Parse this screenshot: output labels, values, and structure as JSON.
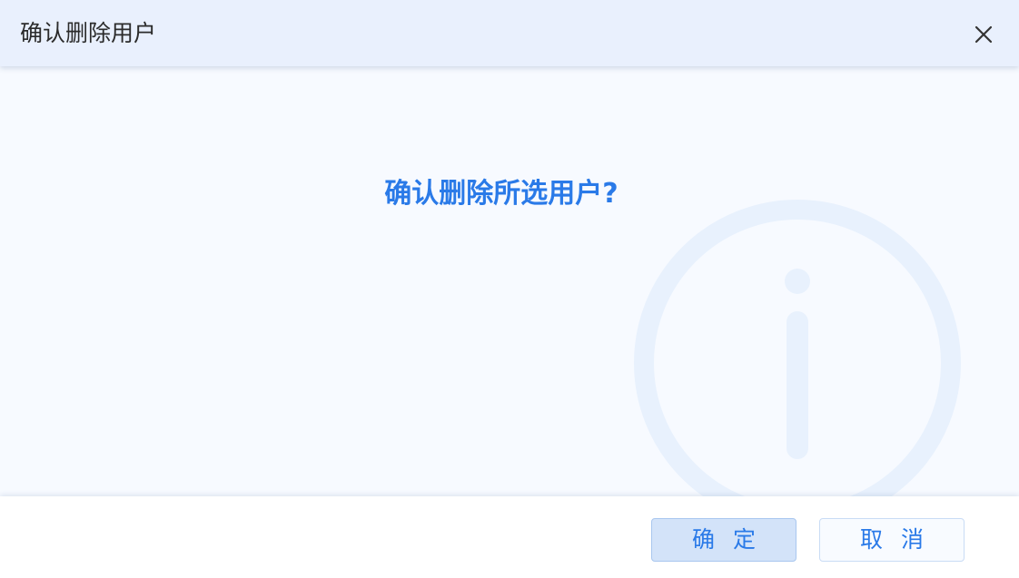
{
  "dialog": {
    "title": "确认删除用户",
    "message": "确认删除所选用户?",
    "confirm_label": "确 定",
    "cancel_label": "取 消",
    "close_icon": "close-icon",
    "watermark_icon": "info-icon"
  },
  "colors": {
    "header_bg": "#e9f0fd",
    "body_bg": "#f7faff",
    "accent": "#2a7ae8",
    "confirm_bg": "#d3e3f9",
    "watermark": "#e6f0fd"
  }
}
